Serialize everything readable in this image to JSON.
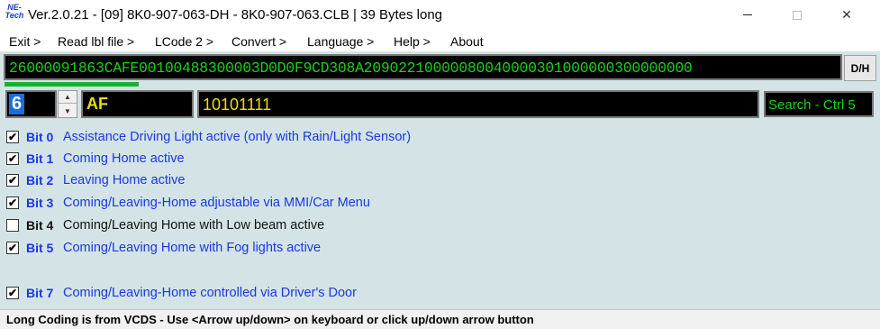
{
  "window": {
    "logo_line1": "NE-",
    "logo_line2": "Tech",
    "title": "Ver.2.0.21 - [09] 8K0-907-063-DH - 8K0-907-063.CLB | 39 Bytes long",
    "minimize_glyph": "",
    "maximize_glyph": "",
    "close_glyph": "✕"
  },
  "menu": {
    "items": [
      "Exit >",
      "Read lbl file >",
      "LCode 2 >",
      "Convert >",
      "Language >",
      "Help >",
      "About"
    ]
  },
  "coding": {
    "value": "26000091863CAFE00100488300003D0D0F9CD308A20902210000080040000301000000300000000",
    "dh_label": "D/H",
    "progress": 0.16
  },
  "byte": {
    "value": "6",
    "hex": "AF",
    "binary": "10101111",
    "search_label": "Search - Ctrl 5"
  },
  "bits": [
    {
      "label": "Bit 0",
      "desc": "Assistance Driving Light active (only with Rain/Light Sensor)",
      "checked": true,
      "check": "✔"
    },
    {
      "label": "Bit 1",
      "desc": "Coming Home active",
      "checked": true,
      "check": "✔"
    },
    {
      "label": "Bit 2",
      "desc": "Leaving Home active",
      "checked": true,
      "check": "✔"
    },
    {
      "label": "Bit 3",
      "desc": "Coming/Leaving-Home adjustable via MMI/Car Menu",
      "checked": true,
      "check": "✔"
    },
    {
      "label": "Bit 4",
      "desc": "Coming/Leaving Home with Low beam active",
      "checked": false,
      "check": ""
    },
    {
      "label": "Bit 5",
      "desc": "Coming/Leaving Home with Fog lights active",
      "checked": true,
      "check": "✔"
    },
    {
      "label": "Bit 7",
      "desc": "Coming/Leaving-Home controlled via Driver's Door",
      "checked": true,
      "check": "✔"
    }
  ],
  "status": {
    "text": "Long Coding is from VCDS - Use <Arrow up/down> on keyboard or click up/down arrow button"
  },
  "colors": {
    "background": "#d4e4e6",
    "bit_on": "#1a37e0",
    "green_text": "#19d119",
    "yellow_text": "#e8e000",
    "selection": "#1e6cd8"
  }
}
